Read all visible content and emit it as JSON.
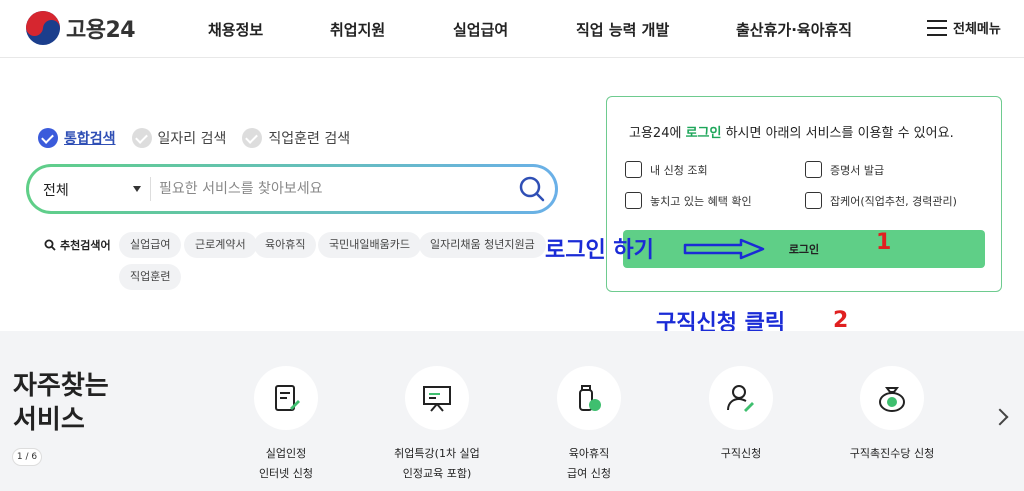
{
  "header": {
    "logo_text": "고용24",
    "nav": [
      "채용정보",
      "취업지원",
      "실업급여",
      "직업 능력 개발",
      "출산휴가·육아휴직"
    ],
    "all_menu_label": "전체메뉴"
  },
  "search": {
    "tabs": [
      {
        "label": "통합검색",
        "checked": true
      },
      {
        "label": "일자리 검색",
        "checked": false
      },
      {
        "label": "직업훈련 검색",
        "checked": false
      }
    ],
    "scope": "전체",
    "placeholder": "필요한 서비스를 찾아보세요",
    "recommend_label": "추천검색어",
    "keywords": [
      "실업급여",
      "근로계약서",
      "육아휴직",
      "국민내일배움카드",
      "일자리채움 청년지원금",
      "직업훈련"
    ]
  },
  "login_card": {
    "title_prefix": "고용24에 ",
    "title_highlight": "로그인",
    "title_suffix": " 하시면 아래의 서비스를 이용할 수 있어요.",
    "items": [
      "내 신청 조회",
      "증명서 발급",
      "놓치고 있는 혜택 확인",
      "잡케어(직업추천, 경력관리)"
    ],
    "login_button": "로그인"
  },
  "annotations": {
    "login_hint": "로그인 하기",
    "step1": "1",
    "job_hint": "구직신청 클릭",
    "step2": "2"
  },
  "frequent": {
    "title_line1": "자주찾는",
    "title_line2": "서비스",
    "pager": "1 / 6",
    "services": [
      {
        "line1": "실업인정",
        "line2": "인터넷 신청",
        "icon": "document-edit-icon"
      },
      {
        "line1": "취업특강(1차 실업",
        "line2": "인정교육 포함)",
        "icon": "presentation-icon"
      },
      {
        "line1": "육아휴직",
        "line2": "급여 신청",
        "icon": "baby-bottle-icon"
      },
      {
        "line1": "구직신청",
        "line2": "",
        "icon": "person-edit-icon"
      },
      {
        "line1": "구직촉진수당 신청",
        "line2": "",
        "icon": "money-bag-icon"
      }
    ]
  },
  "colors": {
    "accent_green": "#5fcf87",
    "brand_blue": "#2f4fb5",
    "annotation_blue": "#1a2bd6",
    "annotation_red": "#e02020"
  }
}
